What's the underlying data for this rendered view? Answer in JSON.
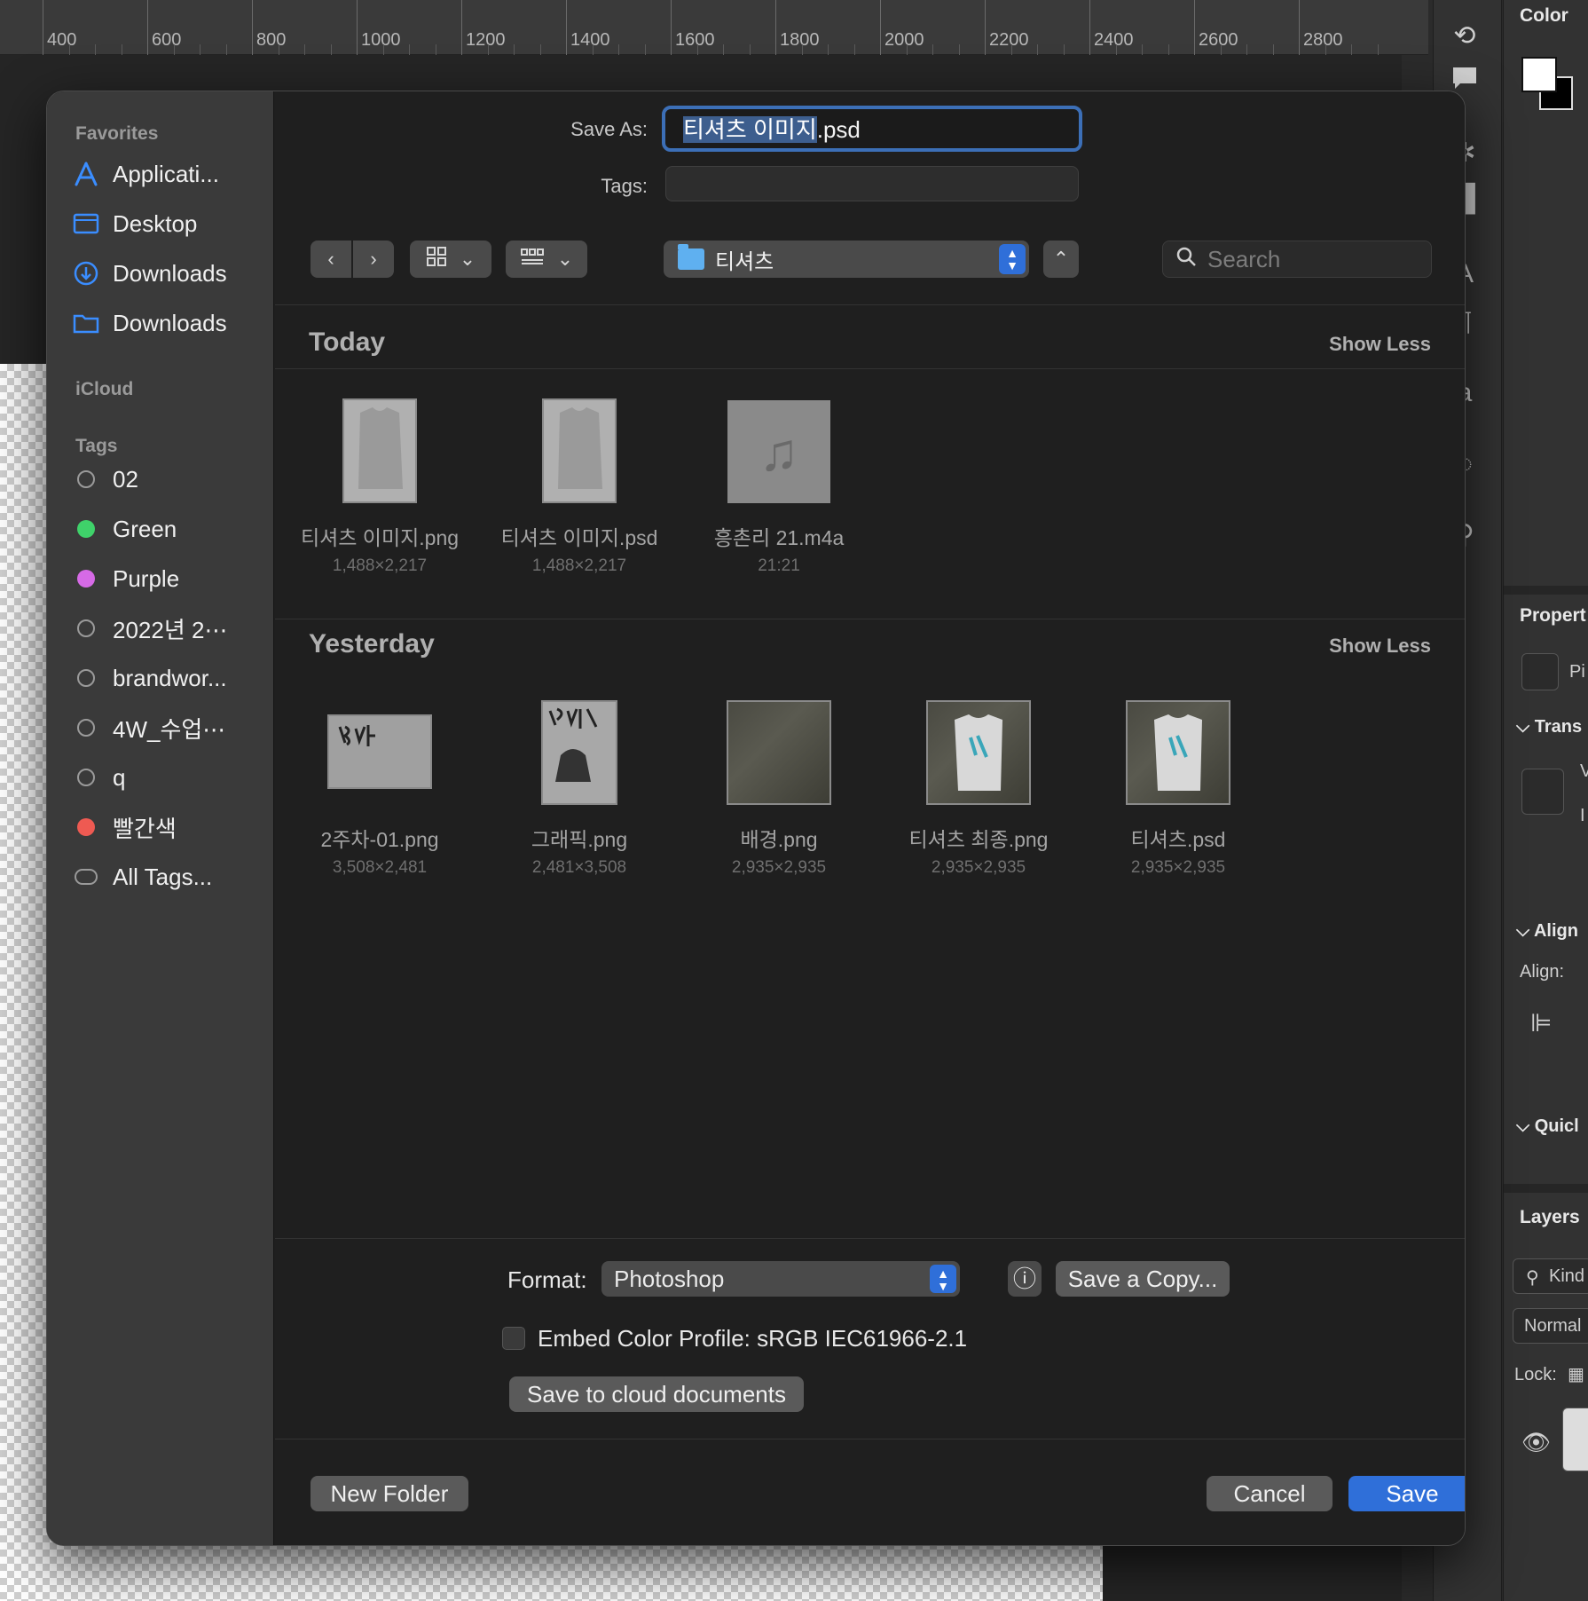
{
  "ruler": {
    "labels": [
      "400",
      "600",
      "800",
      "1000",
      "1200",
      "1400",
      "1600",
      "1800",
      "2000",
      "2200",
      "2400",
      "2600",
      "2800"
    ]
  },
  "panels": {
    "color_title": "Color",
    "properties_title": "Propert",
    "properties_sub": "Pi",
    "transform_title": "Trans",
    "transform_w": "V",
    "transform_h": "I",
    "align_title": "Align",
    "align_label": "Align:",
    "quick_title": "Quicl",
    "layers_title": "Layers",
    "layers_kind": "Kind",
    "layers_blend": "Normal",
    "layers_lock": "Lock:"
  },
  "dialog": {
    "sidebar": {
      "favorites_heading": "Favorites",
      "favorites": [
        {
          "label": "Applicati...",
          "icon": "applications-icon"
        },
        {
          "label": "Desktop",
          "icon": "desktop-icon"
        },
        {
          "label": "Downloads",
          "icon": "downloads-icon"
        },
        {
          "label": "Downloads",
          "icon": "folder-icon"
        }
      ],
      "icloud_heading": "iCloud",
      "tags_heading": "Tags",
      "tags": [
        {
          "label": "02",
          "color": ""
        },
        {
          "label": "Green",
          "color": "#3fd26a"
        },
        {
          "label": "Purple",
          "color": "#d66ae6"
        },
        {
          "label": "2022년 2⋯",
          "color": ""
        },
        {
          "label": "brandwor...",
          "color": ""
        },
        {
          "label": "4W_수업⋯",
          "color": ""
        },
        {
          "label": "q",
          "color": ""
        },
        {
          "label": "빨간색",
          "color": "#ee5a52"
        },
        {
          "label": "All Tags...",
          "color": ""
        }
      ]
    },
    "save_as_label": "Save As:",
    "save_as_selected": "티셔츠 이미지",
    "save_as_ext": ".psd",
    "tags_label": "Tags:",
    "location": "티셔츠",
    "search_placeholder": "Search",
    "sections": [
      {
        "title": "Today",
        "toggle": "Show Less",
        "files": [
          {
            "name": "티셔츠 이미지.png",
            "meta": "1,488×2,217"
          },
          {
            "name": "티셔츠 이미지.psd",
            "meta": "1,488×2,217"
          },
          {
            "name": "흥촌리 21.m4a",
            "meta": "21:21"
          }
        ]
      },
      {
        "title": "Yesterday",
        "toggle": "Show Less",
        "files": [
          {
            "name": "2주차-01.png",
            "meta": "3,508×2,481"
          },
          {
            "name": "그래픽.png",
            "meta": "2,481×3,508"
          },
          {
            "name": "배경.png",
            "meta": "2,935×2,935"
          },
          {
            "name": "티셔츠 최종.png",
            "meta": "2,935×2,935"
          },
          {
            "name": "티셔츠.psd",
            "meta": "2,935×2,935"
          }
        ]
      }
    ],
    "format_label": "Format:",
    "format_value": "Photoshop",
    "save_copy": "Save a Copy...",
    "embed_label": "Embed Color Profile:  sRGB IEC61966-2.1",
    "cloud_button": "Save to cloud documents",
    "new_folder": "New Folder",
    "cancel": "Cancel",
    "save": "Save"
  },
  "colors": {
    "accent": "#2f6fd9",
    "focus_ring": "#3c6fb7"
  }
}
